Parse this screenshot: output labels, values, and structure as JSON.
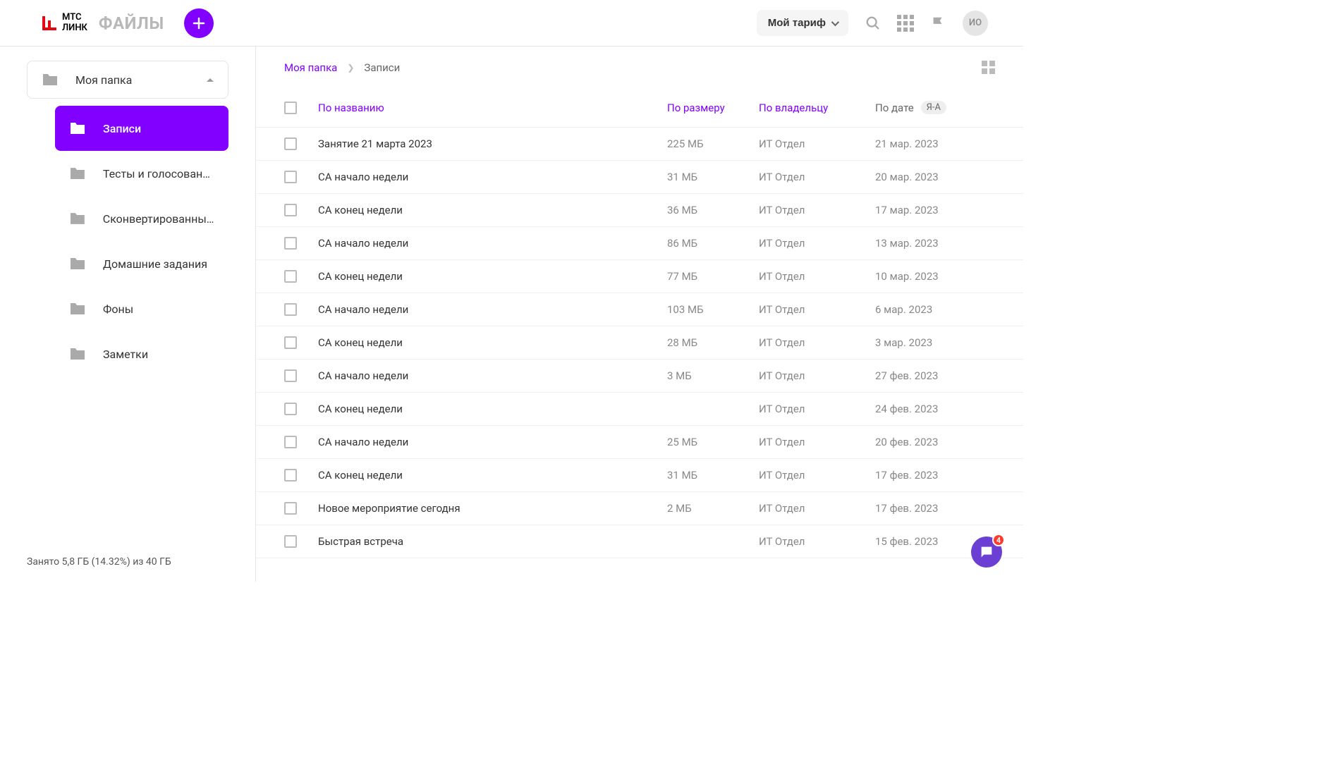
{
  "header": {
    "logo_text_line1": "МТС",
    "logo_text_line2": "ЛИНК",
    "page_title": "ФАЙЛЫ",
    "tariff_label": "Мой тариф",
    "avatar_initials": "ИО"
  },
  "sidebar": {
    "root_folder": "Моя папка",
    "items": [
      {
        "label": "Записи",
        "active": true
      },
      {
        "label": "Тесты и голосования",
        "active": false
      },
      {
        "label": "Сконвертированны...",
        "active": false
      },
      {
        "label": "Домашние задания",
        "active": false
      },
      {
        "label": "Фоны",
        "active": false
      },
      {
        "label": "Заметки",
        "active": false
      }
    ],
    "storage_text": "Занято 5,8 ГБ (14.32%) из 40 ГБ"
  },
  "breadcrumb": {
    "root": "Моя папка",
    "current": "Записи"
  },
  "table": {
    "headers": {
      "name": "По названию",
      "size": "По размеру",
      "owner": "По владельцу",
      "date": "По дате",
      "sort_badge": "Я-А"
    },
    "rows": [
      {
        "name": "Занятие 21 марта 2023",
        "size": "225 МБ",
        "owner": "ИТ Отдел",
        "date": "21 мар. 2023"
      },
      {
        "name": "СА начало недели",
        "size": "31 МБ",
        "owner": "ИТ Отдел",
        "date": "20 мар. 2023"
      },
      {
        "name": "СА конец недели",
        "size": "36 МБ",
        "owner": "ИТ Отдел",
        "date": "17 мар. 2023"
      },
      {
        "name": "СА начало недели",
        "size": "86 МБ",
        "owner": "ИТ Отдел",
        "date": "13 мар. 2023"
      },
      {
        "name": "СА конец недели",
        "size": "77 МБ",
        "owner": "ИТ Отдел",
        "date": "10 мар. 2023"
      },
      {
        "name": "СА начало недели",
        "size": "103 МБ",
        "owner": "ИТ Отдел",
        "date": "6 мар. 2023"
      },
      {
        "name": "СА конец недели",
        "size": "28 МБ",
        "owner": "ИТ Отдел",
        "date": "3 мар. 2023"
      },
      {
        "name": "СА начало недели",
        "size": "3 МБ",
        "owner": "ИТ Отдел",
        "date": "27 фев. 2023"
      },
      {
        "name": "СА конец недели",
        "size": "",
        "owner": "ИТ Отдел",
        "date": "24 фев. 2023"
      },
      {
        "name": "СА начало недели",
        "size": "25 МБ",
        "owner": "ИТ Отдел",
        "date": "20 фев. 2023"
      },
      {
        "name": "СА конец недели",
        "size": "31 МБ",
        "owner": "ИТ Отдел",
        "date": "17 фев. 2023"
      },
      {
        "name": "Новое мероприятие сегодня",
        "size": "2 МБ",
        "owner": "ИТ Отдел",
        "date": "17 фев. 2023"
      },
      {
        "name": "Быстрая встреча",
        "size": "",
        "owner": "ИТ Отдел",
        "date": "15 фев. 2023"
      }
    ]
  },
  "chat_badge": "4"
}
